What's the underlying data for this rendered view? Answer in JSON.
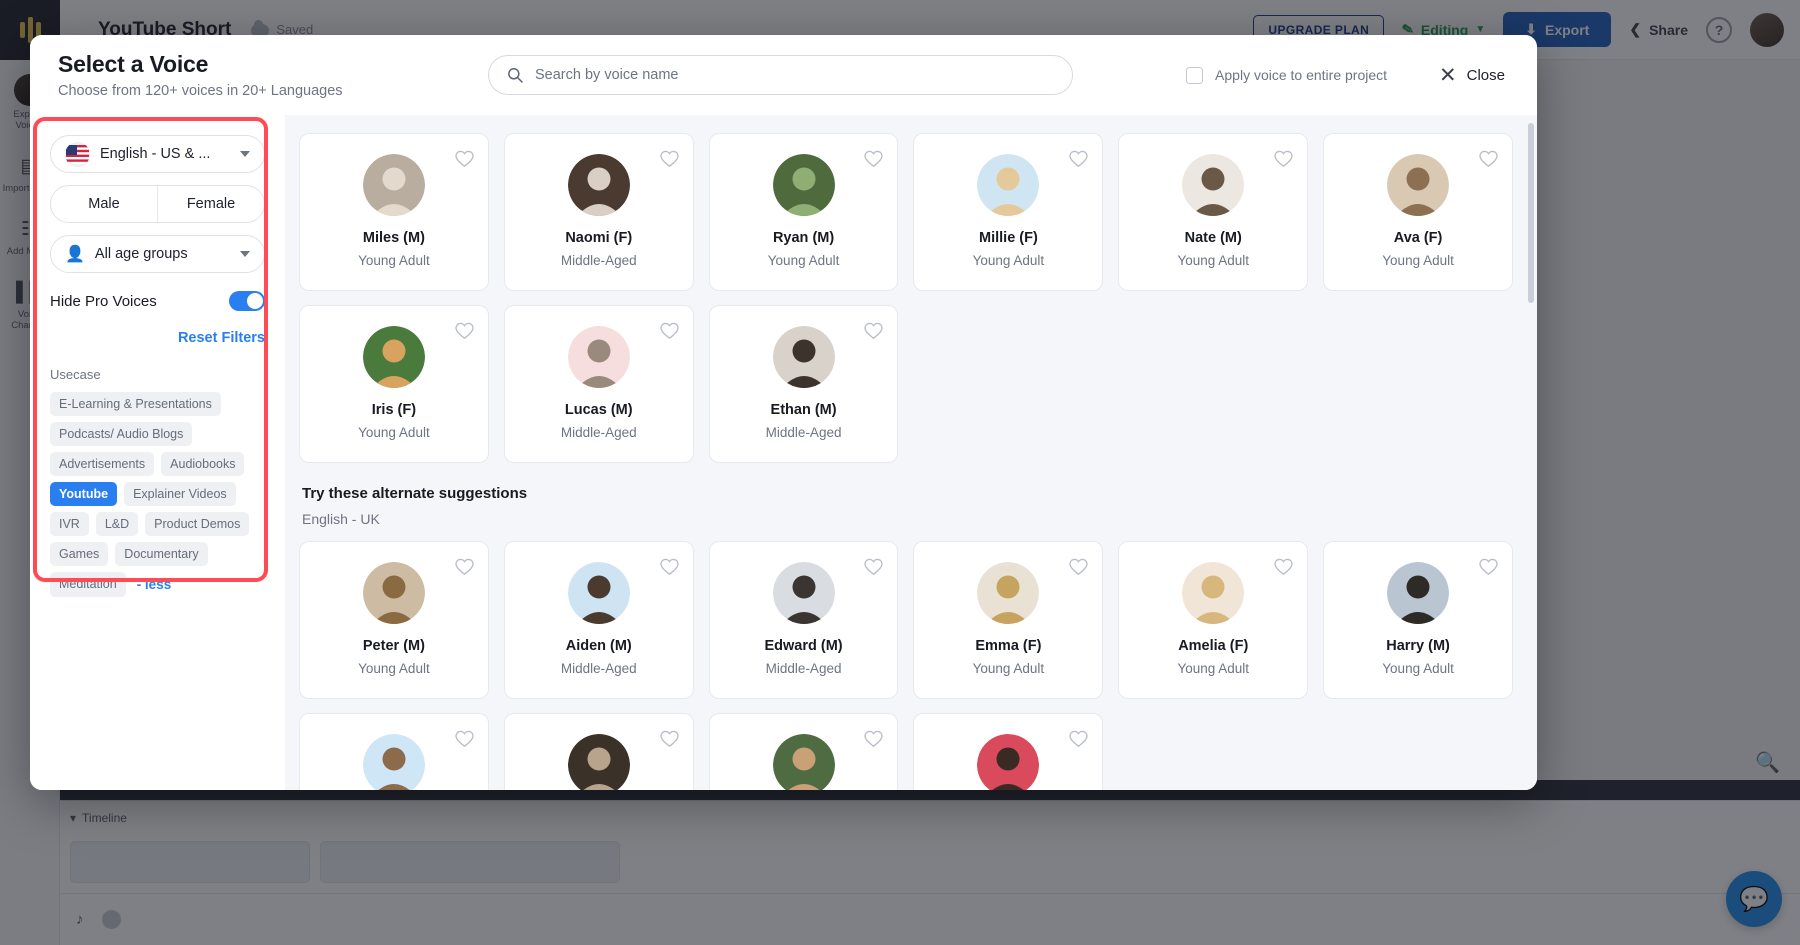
{
  "app": {
    "project_title": "YouTube Short",
    "saved_label": "Saved",
    "upgrade_label": "UPGRADE PLAN",
    "editing_label": "Editing",
    "export_label": "Export",
    "share_label": "Share",
    "help_label": "?",
    "rail_items": [
      {
        "label": "Explore Voices",
        "icon": "user-circle-icon"
      },
      {
        "label": "Import Script",
        "icon": "document-icon"
      },
      {
        "label": "Add Media",
        "icon": "media-icon"
      },
      {
        "label": "Voice Changer",
        "icon": "waveform-icon"
      }
    ],
    "timeline_label": "Timeline",
    "chat_icon": "chat-bubble-icon"
  },
  "modal": {
    "title": "Select a Voice",
    "subtitle": "Choose from 120+ voices in 20+ Languages",
    "search": {
      "placeholder": "Search by voice name",
      "icon": "search-icon",
      "value": ""
    },
    "apply_to_project": {
      "label": "Apply voice to entire project",
      "checked": false
    },
    "close": {
      "label": "Close",
      "icon": "close-icon"
    }
  },
  "filters": {
    "language": {
      "value": "English - US & ...",
      "flag": "us-flag-icon",
      "icon": "chevron-down-icon"
    },
    "gender": {
      "options": [
        "Male",
        "Female"
      ],
      "selected": ""
    },
    "age": {
      "value": "All age groups",
      "icon": "person-icon"
    },
    "hide_pro_voices": {
      "label": "Hide Pro Voices",
      "enabled": true
    },
    "reset_label": "Reset Filters",
    "usecase_label": "Usecase",
    "usecase_tags": [
      {
        "label": "E-Learning & Presentations",
        "selected": false
      },
      {
        "label": "Podcasts/ Audio Blogs",
        "selected": false
      },
      {
        "label": "Advertisements",
        "selected": false
      },
      {
        "label": "Audiobooks",
        "selected": false
      },
      {
        "label": "Youtube",
        "selected": true
      },
      {
        "label": "Explainer Videos",
        "selected": false
      },
      {
        "label": "IVR",
        "selected": false
      },
      {
        "label": "L&D",
        "selected": false
      },
      {
        "label": "Product Demos",
        "selected": false
      },
      {
        "label": "Games",
        "selected": false
      },
      {
        "label": "Documentary",
        "selected": false
      },
      {
        "label": "Meditation",
        "selected": false
      }
    ],
    "less_label": "- less",
    "highlight_color": "#ff4b55",
    "accent_color": "#2a7ff0"
  },
  "voices": {
    "primary": [
      {
        "name": "Miles (M)",
        "age": "Young Adult",
        "av1": "#b9ada0",
        "av2": "#e3d9cd"
      },
      {
        "name": "Naomi (F)",
        "age": "Middle-Aged",
        "av1": "#4a3a30",
        "av2": "#d9cfc5"
      },
      {
        "name": "Ryan (M)",
        "age": "Young Adult",
        "av1": "#4f6b3e",
        "av2": "#8fae74"
      },
      {
        "name": "Millie (F)",
        "age": "Young Adult",
        "av1": "#cfe6f2",
        "av2": "#e6c99a"
      },
      {
        "name": "Nate (M)",
        "age": "Young Adult",
        "av1": "#ece7e0",
        "av2": "#6b5948"
      },
      {
        "name": "Ava (F)",
        "age": "Young Adult",
        "av1": "#d9c9b2",
        "av2": "#8d6f52"
      },
      {
        "name": "Iris (F)",
        "age": "Young Adult",
        "av1": "#4a7a3c",
        "av2": "#d7a35f"
      },
      {
        "name": "Lucas (M)",
        "age": "Middle-Aged",
        "av1": "#f6dede",
        "av2": "#9a8a7e"
      },
      {
        "name": "Ethan (M)",
        "age": "Middle-Aged",
        "av1": "#d8d2ca",
        "av2": "#3b332c"
      }
    ],
    "alternate_title": "Try these alternate suggestions",
    "alternate_lang": "English - UK",
    "alternate": [
      {
        "name": "Peter (M)",
        "age": "Young Adult",
        "av1": "#cdbca3",
        "av2": "#8a6a40"
      },
      {
        "name": "Aiden (M)",
        "age": "Middle-Aged",
        "av1": "#cfe4f3",
        "av2": "#4a3b2e"
      },
      {
        "name": "Edward (M)",
        "age": "Middle-Aged",
        "av1": "#d9dde2",
        "av2": "#3a3530"
      },
      {
        "name": "Emma (F)",
        "age": "Young Adult",
        "av1": "#e9e2d4",
        "av2": "#c6a35e"
      },
      {
        "name": "Amelia (F)",
        "age": "Young Adult",
        "av1": "#f1e5d8",
        "av2": "#d8b77e"
      },
      {
        "name": "Harry (M)",
        "age": "Young Adult",
        "av1": "#b9c6d2",
        "av2": "#2e2a26"
      }
    ],
    "partial_row": [
      {
        "av1": "#cfe6f7",
        "av2": "#8c6b4a"
      },
      {
        "av1": "#3a3128",
        "av2": "#b8a48c"
      },
      {
        "av1": "#4e6b42",
        "av2": "#caa077"
      },
      {
        "av1": "#d94a5c",
        "av2": "#3a2a24"
      }
    ],
    "heart_icon": "heart-icon"
  }
}
